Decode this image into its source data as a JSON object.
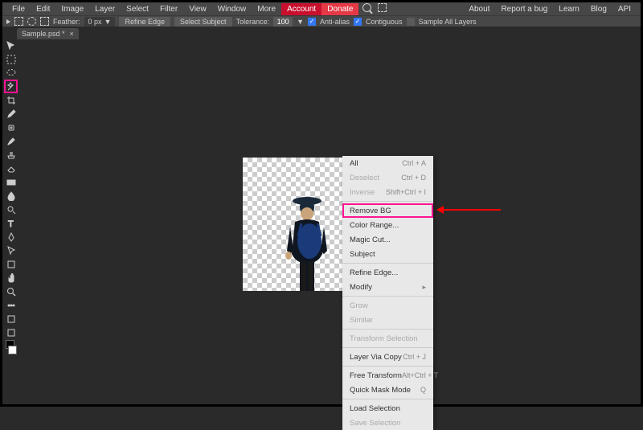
{
  "menubar": {
    "left": [
      "File",
      "Edit",
      "Image",
      "Layer",
      "Select",
      "Filter",
      "View",
      "Window",
      "More"
    ],
    "account": "Account",
    "donate": "Donate",
    "right": [
      "About",
      "Report a bug",
      "Learn",
      "Blog",
      "API"
    ]
  },
  "optbar": {
    "feather_label": "Feather:",
    "feather_value": "0 px",
    "refine_edge": "Refine Edge",
    "select_subject": "Select Subject",
    "tolerance_label": "Tolerance:",
    "tolerance_value": "100",
    "anti_alias": "Anti-alias",
    "contiguous": "Contiguous",
    "sample_all": "Sample All Layers"
  },
  "tab": {
    "name": "Sample.psd *"
  },
  "context_menu": [
    {
      "label": "All",
      "shortcut": "Ctrl + A",
      "disabled": false
    },
    {
      "label": "Deselect",
      "shortcut": "Ctrl + D",
      "disabled": true
    },
    {
      "label": "Inverse",
      "shortcut": "Shift+Ctrl + I",
      "disabled": true
    },
    {
      "sep": true
    },
    {
      "label": "Remove BG",
      "highlight": true
    },
    {
      "label": "Color Range...",
      "disabled": false
    },
    {
      "label": "Magic Cut...",
      "disabled": false
    },
    {
      "label": "Subject",
      "disabled": false
    },
    {
      "sep": true
    },
    {
      "label": "Refine Edge...",
      "disabled": false
    },
    {
      "label": "Modify",
      "submenu": true
    },
    {
      "sep": true
    },
    {
      "label": "Grow",
      "disabled": true
    },
    {
      "label": "Similar",
      "disabled": true
    },
    {
      "sep": true
    },
    {
      "label": "Transform Selection",
      "disabled": true
    },
    {
      "sep": true
    },
    {
      "label": "Layer Via Copy",
      "shortcut": "Ctrl + J",
      "disabled": false
    },
    {
      "sep": true
    },
    {
      "label": "Free Transform",
      "shortcut": "Alt+Ctrl + T",
      "disabled": false
    },
    {
      "label": "Quick Mask Mode",
      "shortcut": "Q",
      "disabled": false
    },
    {
      "sep": true
    },
    {
      "label": "Load Selection",
      "disabled": false
    },
    {
      "label": "Save Selection",
      "disabled": true
    }
  ],
  "tools": [
    "move",
    "rect-select",
    "ellipse-select",
    "lasso",
    "magic-wand",
    "crop",
    "eyedropper",
    "healing",
    "brush",
    "clone",
    "eraser",
    "gradient",
    "blur",
    "dodge",
    "pen",
    "text",
    "path-select",
    "rectangle",
    "hand",
    "zoom",
    "more1",
    "more2",
    "more3"
  ]
}
